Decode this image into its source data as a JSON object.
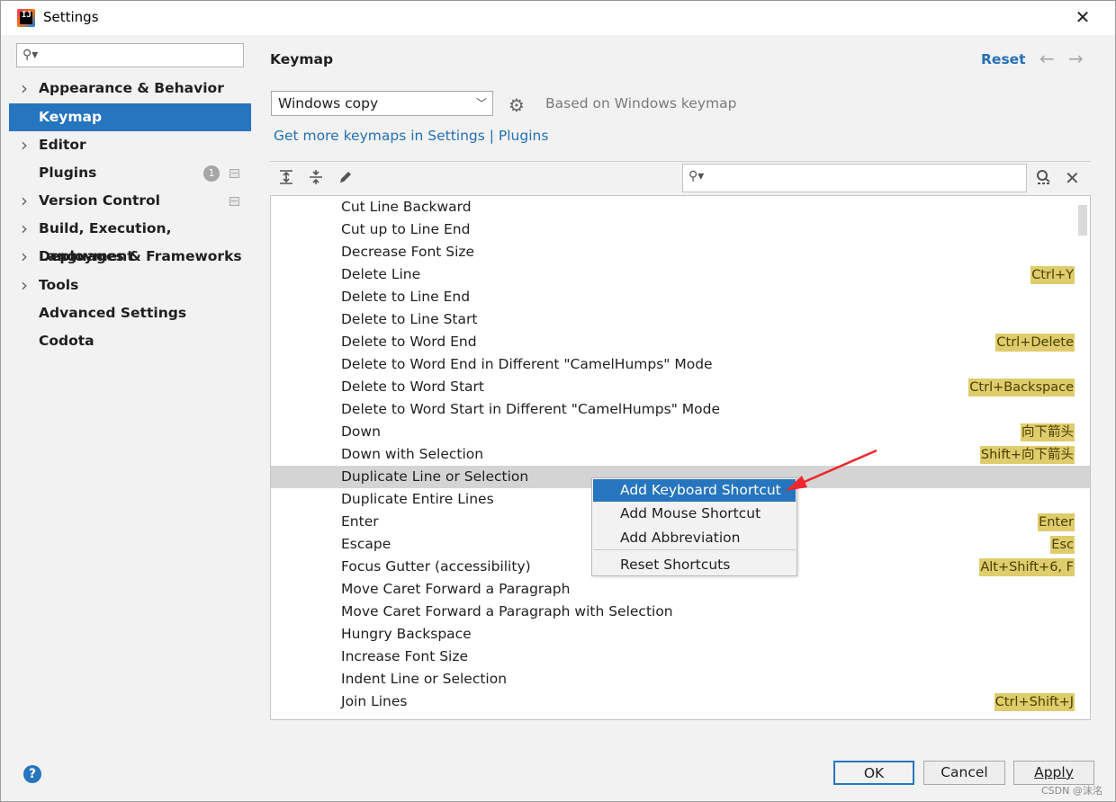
{
  "window": {
    "title": "Settings"
  },
  "sidebar": {
    "search_placeholder": "",
    "items": [
      {
        "label": "Appearance & Behavior",
        "expandable": true
      },
      {
        "label": "Keymap",
        "expandable": false,
        "selected": true
      },
      {
        "label": "Editor",
        "expandable": true
      },
      {
        "label": "Plugins",
        "expandable": false,
        "badge": "1"
      },
      {
        "label": "Version Control",
        "expandable": true
      },
      {
        "label": "Build, Execution, Deployment",
        "expandable": true
      },
      {
        "label": "Languages & Frameworks",
        "expandable": true
      },
      {
        "label": "Tools",
        "expandable": true
      },
      {
        "label": "Advanced Settings",
        "expandable": false
      },
      {
        "label": "Codota",
        "expandable": false
      }
    ]
  },
  "main": {
    "title": "Keymap",
    "reset_label": "Reset",
    "keymap_selected": "Windows copy",
    "based_on": "Based on Windows keymap",
    "get_more": "Get more keymaps in Settings | Plugins",
    "filter_placeholder": "",
    "actions": [
      {
        "name": "Cut Line Backward",
        "shortcut": ""
      },
      {
        "name": "Cut up to Line End",
        "shortcut": ""
      },
      {
        "name": "Decrease Font Size",
        "shortcut": ""
      },
      {
        "name": "Delete Line",
        "shortcut": "Ctrl+Y"
      },
      {
        "name": "Delete to Line End",
        "shortcut": ""
      },
      {
        "name": "Delete to Line Start",
        "shortcut": ""
      },
      {
        "name": "Delete to Word End",
        "shortcut": "Ctrl+Delete"
      },
      {
        "name": "Delete to Word End in Different \"CamelHumps\" Mode",
        "shortcut": ""
      },
      {
        "name": "Delete to Word Start",
        "shortcut": "Ctrl+Backspace"
      },
      {
        "name": "Delete to Word Start in Different \"CamelHumps\" Mode",
        "shortcut": ""
      },
      {
        "name": "Down",
        "shortcut": "向下箭头"
      },
      {
        "name": "Down with Selection",
        "shortcut": "Shift+向下箭头"
      },
      {
        "name": "Duplicate Line or Selection",
        "shortcut": "",
        "highlighted": true
      },
      {
        "name": "Duplicate Entire Lines",
        "shortcut": ""
      },
      {
        "name": "Enter",
        "shortcut": "Enter"
      },
      {
        "name": "Escape",
        "shortcut": "Esc"
      },
      {
        "name": "Focus Gutter (accessibility)",
        "shortcut": "Alt+Shift+6, F"
      },
      {
        "name": "Move Caret Forward a Paragraph",
        "shortcut": ""
      },
      {
        "name": "Move Caret Forward a Paragraph with Selection",
        "shortcut": ""
      },
      {
        "name": "Hungry Backspace",
        "shortcut": ""
      },
      {
        "name": "Increase Font Size",
        "shortcut": ""
      },
      {
        "name": "Indent Line or Selection",
        "shortcut": ""
      },
      {
        "name": "Join Lines",
        "shortcut": "Ctrl+Shift+J"
      }
    ]
  },
  "context_menu": {
    "items": [
      {
        "label": "Add Keyboard Shortcut",
        "active": true
      },
      {
        "label": "Add Mouse Shortcut",
        "active": false
      },
      {
        "label": "Add Abbreviation",
        "active": false
      },
      {
        "label": "Reset Shortcuts",
        "active": false
      }
    ]
  },
  "footer": {
    "ok_label": "OK",
    "cancel_label": "Cancel",
    "apply_label": "Apply"
  },
  "watermark": "CSDN @沫洺",
  "colors": {
    "accent": "#2675bf",
    "shortcut_bg": "#dfcc6c",
    "link": "#2470b3",
    "annotation_arrow": "#f0262c"
  }
}
